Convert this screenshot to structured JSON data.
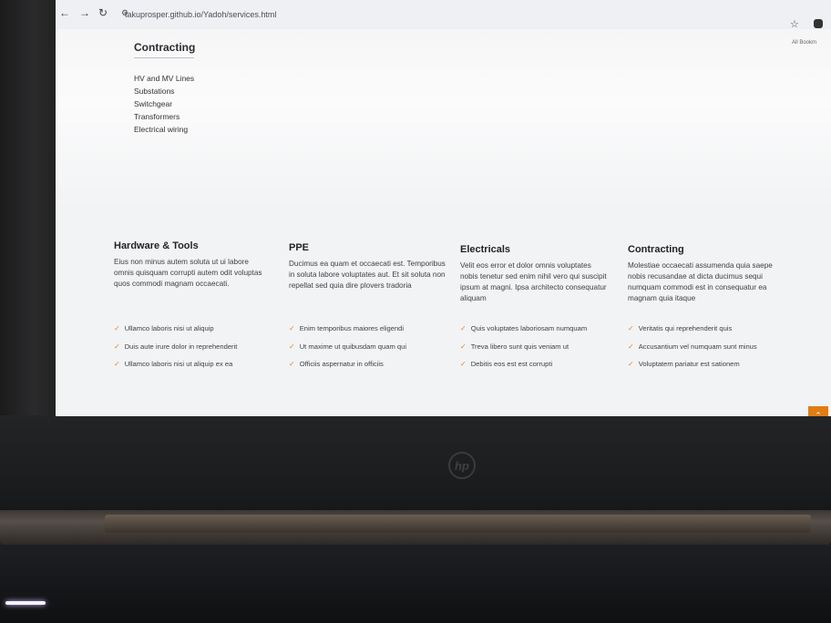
{
  "browser": {
    "url": "takuprosper.github.io/Yadoh/services.html",
    "bookmark_label": "All Bookm"
  },
  "upper": {
    "title": "Contracting",
    "items": [
      "HV and MV Lines",
      "Substations",
      "Switchgear",
      "Transformers",
      "Electrical wiring"
    ]
  },
  "cards": [
    {
      "title": "Hardware & Tools",
      "desc": "Eius non minus autem soluta ut ui labore omnis quisquam corrupti autem odit voluptas quos commodi magnam occaecati.",
      "items": [
        "Ullamco laboris nisi ut aliquip",
        "Duis aute irure dolor in reprehenderit",
        "Ullamco laboris nisi ut aliquip ex ea"
      ]
    },
    {
      "title": "PPE",
      "desc": "Ducimus ea quam et occaecati est. Temporibus in soluta labore voluptates aut. Et sit soluta non repellat sed quia dire plovers tradoria",
      "items": [
        "Enim temporibus maiores eligendi",
        "Ut maxime ut quibusdam quam qui",
        "Officiis aspernatur in officiis"
      ]
    },
    {
      "title": "Electricals",
      "desc": "Velit eos error et dolor omnis voluptates nobis tenetur sed enim nihil vero qui suscipit ipsum at magni. Ipsa architecto consequatur aliquam",
      "items": [
        "Quis voluptates laboriosam numquam",
        "Treva libero sunt quis veniam ut",
        "Debitis eos est est corrupti"
      ]
    },
    {
      "title": "Contracting",
      "desc": "Molestiae occaecati assumenda quia saepe nobis recusandae at dicta ducimus sequi numquam commodi est in consequatur ea magnam quia itaque",
      "items": [
        "Veritatis qui reprehenderit quis",
        "Accusantium vel numquam sunt minus",
        "Voluptatem pariatur est sationem"
      ]
    }
  ],
  "accent_color": "#e07d14"
}
